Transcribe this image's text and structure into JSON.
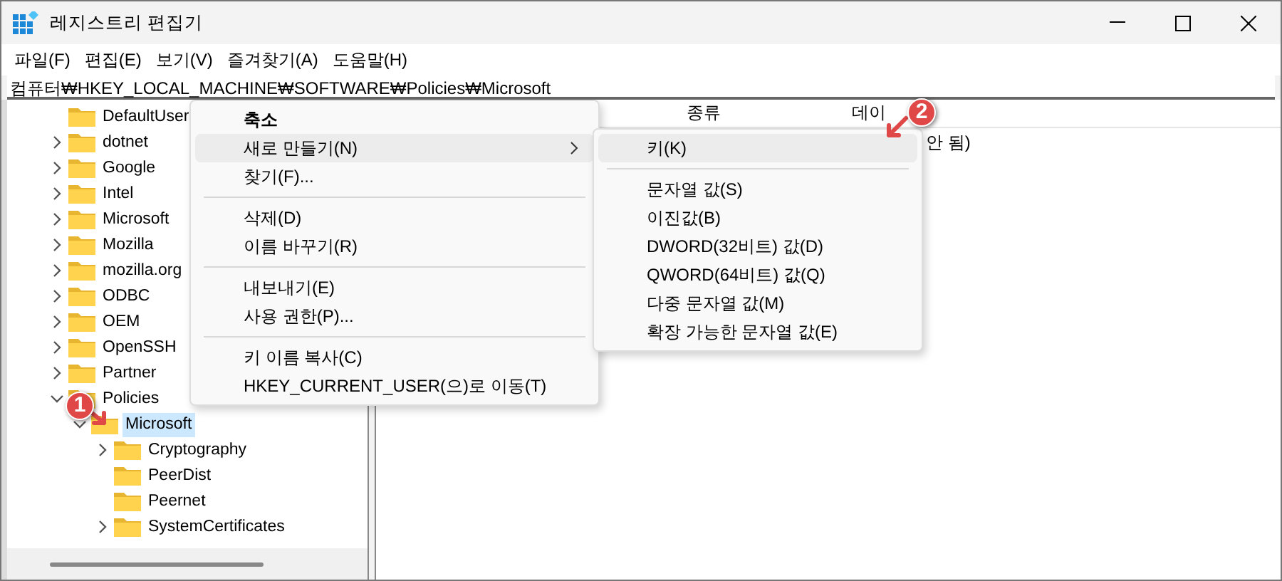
{
  "window": {
    "title": "레지스트리 편집기"
  },
  "menu_bar": [
    "파일(F)",
    "편집(E)",
    "보기(V)",
    "즐겨찾기(A)",
    "도움말(H)"
  ],
  "address": "컴퓨터₩HKEY_LOCAL_MACHINE₩SOFTWARE₩Policies₩Microsoft",
  "tree": [
    {
      "label": "DefaultUser",
      "kind": "leaf",
      "selected": false
    },
    {
      "label": "dotnet",
      "kind": "branch",
      "expanded": false,
      "selected": false
    },
    {
      "label": "Google",
      "kind": "branch",
      "expanded": false,
      "selected": false
    },
    {
      "label": "Intel",
      "kind": "branch",
      "expanded": false,
      "selected": false
    },
    {
      "label": "Microsoft",
      "kind": "branch",
      "expanded": false,
      "selected": false
    },
    {
      "label": "Mozilla",
      "kind": "branch",
      "expanded": false,
      "selected": false
    },
    {
      "label": "mozilla.org",
      "kind": "branch",
      "expanded": false,
      "selected": false
    },
    {
      "label": "ODBC",
      "kind": "branch",
      "expanded": false,
      "selected": false
    },
    {
      "label": "OEM",
      "kind": "branch",
      "expanded": false,
      "selected": false
    },
    {
      "label": "OpenSSH",
      "kind": "branch",
      "expanded": false,
      "selected": false
    },
    {
      "label": "Partner",
      "kind": "branch",
      "expanded": false,
      "selected": false
    },
    {
      "label": "Policies",
      "kind": "branch",
      "expanded": true,
      "selected": false,
      "children": [
        {
          "label": "Microsoft",
          "kind": "branch",
          "expanded": true,
          "selected": true,
          "children": [
            {
              "label": "Cryptography",
              "kind": "branch",
              "expanded": false,
              "selected": false
            },
            {
              "label": "PeerDist",
              "kind": "leaf",
              "selected": false
            },
            {
              "label": "Peernet",
              "kind": "leaf",
              "selected": false
            },
            {
              "label": "SystemCertificates",
              "kind": "branch",
              "expanded": false,
              "selected": false
            }
          ]
        }
      ]
    }
  ],
  "columns": [
    "종류",
    "데이"
  ],
  "values": [
    {
      "column_3": "안 됨)"
    }
  ],
  "context_menu": [
    {
      "kind": "item",
      "label": "축소",
      "bold": true,
      "selected": false
    },
    {
      "kind": "submenu",
      "label": "새로 만들기(N)",
      "selected": true
    },
    {
      "kind": "item",
      "label": "찾기(F)...",
      "selected": false
    },
    {
      "kind": "separator"
    },
    {
      "kind": "item",
      "label": "삭제(D)",
      "selected": false
    },
    {
      "kind": "item",
      "label": "이름 바꾸기(R)",
      "selected": false
    },
    {
      "kind": "separator"
    },
    {
      "kind": "item",
      "label": "내보내기(E)",
      "selected": false
    },
    {
      "kind": "item",
      "label": "사용 권한(P)...",
      "selected": false
    },
    {
      "kind": "separator"
    },
    {
      "kind": "item",
      "label": "키 이름 복사(C)",
      "selected": false
    },
    {
      "kind": "item",
      "label": "HKEY_CURRENT_USER(으)로 이동(T)",
      "selected": false
    }
  ],
  "submenu": [
    {
      "kind": "item",
      "label": "키(K)",
      "selected": true
    },
    {
      "kind": "separator"
    },
    {
      "kind": "item",
      "label": "문자열 값(S)",
      "selected": false
    },
    {
      "kind": "item",
      "label": "이진값(B)",
      "selected": false
    },
    {
      "kind": "item",
      "label": "DWORD(32비트) 값(D)",
      "selected": false
    },
    {
      "kind": "item",
      "label": "QWORD(64비트) 값(Q)",
      "selected": false
    },
    {
      "kind": "item",
      "label": "다중 문자열 값(M)",
      "selected": false
    },
    {
      "kind": "item",
      "label": "확장 가능한 문자열 값(E)",
      "selected": false
    }
  ],
  "callouts": [
    "1",
    "2"
  ]
}
